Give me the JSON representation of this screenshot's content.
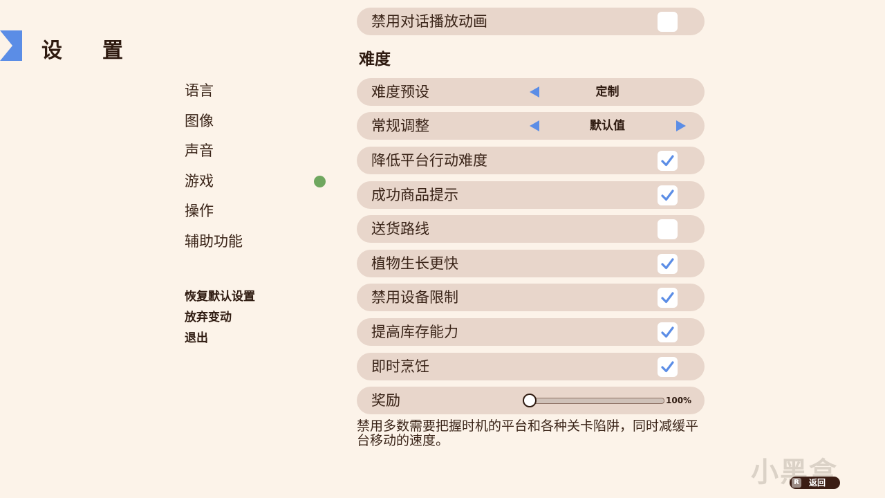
{
  "header": {
    "title": "设置"
  },
  "nav": {
    "items": [
      {
        "label": "语言"
      },
      {
        "label": "图像"
      },
      {
        "label": "声音"
      },
      {
        "label": "游戏"
      },
      {
        "label": "操作"
      },
      {
        "label": "辅助功能"
      }
    ],
    "active_index": 3,
    "actions": [
      {
        "label": "恢复默认设置"
      },
      {
        "label": "放弃变动"
      },
      {
        "label": "退出"
      }
    ]
  },
  "settings": {
    "top_row": {
      "label": "禁用对话播放动画",
      "checked": false
    },
    "section_title": "难度",
    "difficulty_preset": {
      "label": "难度预设",
      "value": "定制"
    },
    "general_adjust": {
      "label": "常规调整",
      "value": "默认值"
    },
    "toggles": [
      {
        "label": "降低平台行动难度",
        "checked": true
      },
      {
        "label": "成功商品提示",
        "checked": true
      },
      {
        "label": "送货路线",
        "checked": false
      },
      {
        "label": "植物生长更快",
        "checked": true
      },
      {
        "label": "禁用设备限制",
        "checked": true
      },
      {
        "label": "提高库存能力",
        "checked": true
      },
      {
        "label": "即时烹饪",
        "checked": true
      }
    ],
    "reward": {
      "label": "奖励",
      "value": "100%",
      "level": 0.0
    },
    "description": "禁用多数需要把握时机的平台和各种关卡陷阱，同时减缓平台移动的速度。"
  },
  "footer": {
    "watermark": "小黑盒",
    "back_key": "R",
    "back_label": "返回"
  },
  "colors": {
    "accent_blue": "#5b8de6",
    "active_dot": "#6fa75f",
    "row_bg": "#e8d6cb",
    "page_bg": "#fcf3e9"
  }
}
